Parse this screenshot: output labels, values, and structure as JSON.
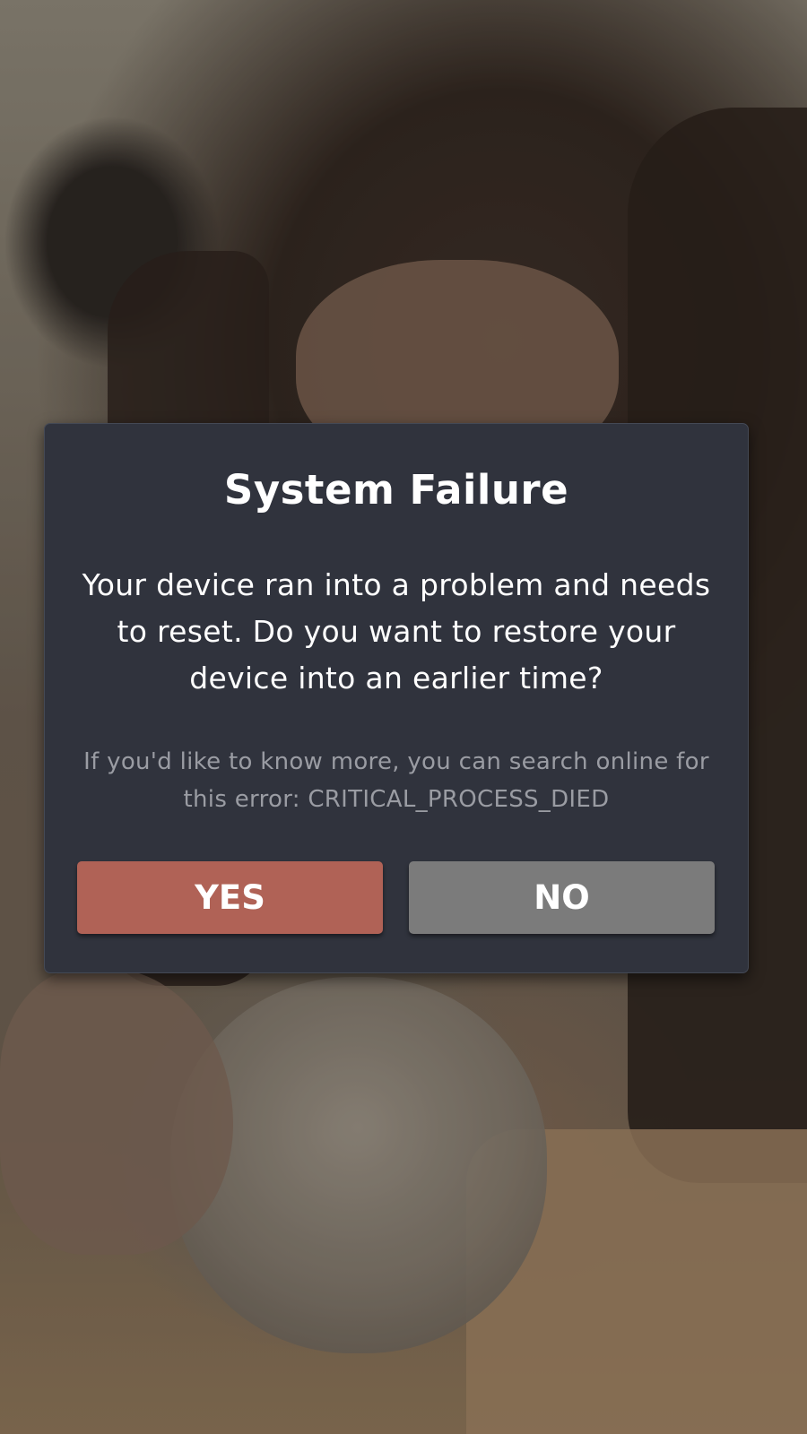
{
  "dialog": {
    "title": "System Failure",
    "message": "Your device ran into a problem and needs to reset. Do you want to restore your device into an earlier time?",
    "note": "If you'd like to know more, you can search online for this error: CRITICAL_PROCESS_DIED",
    "yes_label": "YES",
    "no_label": "NO"
  },
  "colors": {
    "dialog_background": "#30333d",
    "yes_button": "#b06256",
    "no_button": "#7b7b7b",
    "title_text": "#ffffff",
    "note_text": "#9a9ca3"
  }
}
